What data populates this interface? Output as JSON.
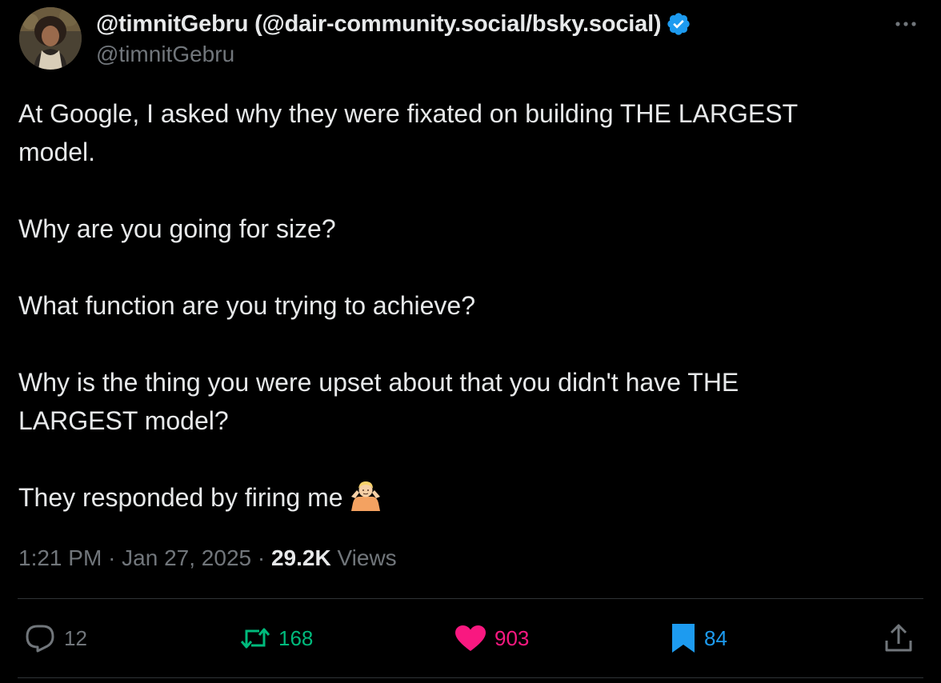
{
  "author": {
    "display_name": "@timnitGebru (@dair-community.social/bsky.social)",
    "handle": "@timnitGebru",
    "verified_color": "#1d9bf0"
  },
  "tweet": {
    "paragraphs": [
      "At Google, I asked why they were fixated on building THE LARGEST",
      "model.",
      "Why are you going for size?",
      "What function are you trying to achieve?",
      "Why is the thing you were upset about that you didn't have THE",
      "LARGEST model?",
      "They responded by firing me"
    ],
    "emoji": "person-shrugging-emoji"
  },
  "meta": {
    "time": "1:21 PM",
    "separator": "·",
    "date": "Jan 27, 2025",
    "views_count": "29.2K",
    "views_label": "Views"
  },
  "actions": {
    "reply_count": "12",
    "retweet_count": "168",
    "like_count": "903",
    "bookmark_count": "84"
  },
  "colors": {
    "background": "#000000",
    "text": "#e7e9ea",
    "muted": "#71767b",
    "retweet": "#00ba7c",
    "like": "#f91880",
    "bookmark": "#1d9bf0"
  }
}
